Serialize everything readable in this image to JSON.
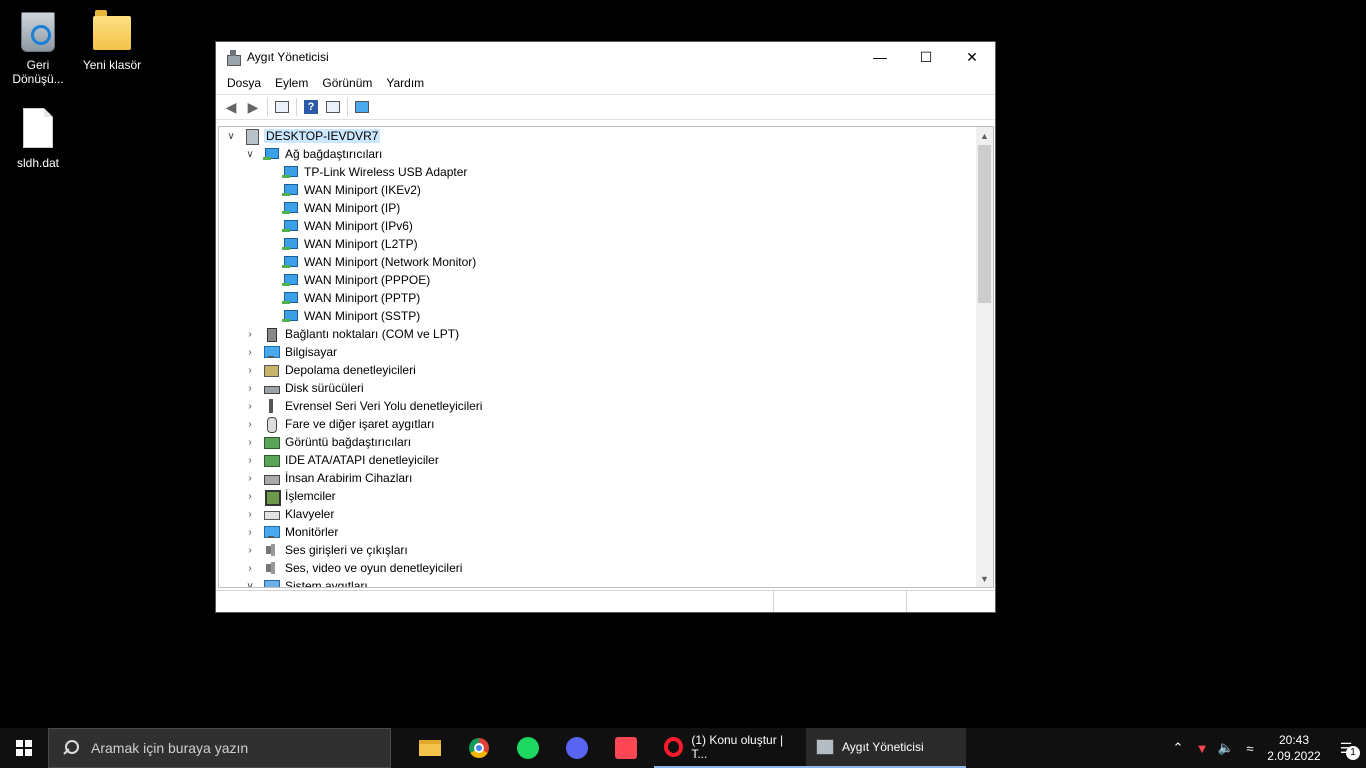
{
  "desktop": {
    "icons": [
      {
        "label": "Geri Dönüşü..."
      },
      {
        "label": "Yeni klasör"
      },
      {
        "label": "sldh.dat"
      }
    ]
  },
  "window": {
    "title": "Aygıt Yöneticisi",
    "controls": {
      "minimize": "—",
      "maximize": "☐",
      "close": "✕"
    },
    "menu": [
      "Dosya",
      "Eylem",
      "Görünüm",
      "Yardım"
    ],
    "tree": {
      "root": "DESKTOP-IEVDVR7",
      "expanded_category": "Ağ bağdaştırıcıları",
      "network_adapters": [
        "TP-Link Wireless USB Adapter",
        "WAN Miniport (IKEv2)",
        "WAN Miniport (IP)",
        "WAN Miniport (IPv6)",
        "WAN Miniport (L2TP)",
        "WAN Miniport (Network Monitor)",
        "WAN Miniport (PPPOE)",
        "WAN Miniport (PPTP)",
        "WAN Miniport (SSTP)"
      ],
      "categories": [
        {
          "label": "Bağlantı noktaları (COM ve LPT)",
          "icon": "port-icon"
        },
        {
          "label": "Bilgisayar",
          "icon": "computer-icon"
        },
        {
          "label": "Depolama denetleyicileri",
          "icon": "storage-controller-icon"
        },
        {
          "label": "Disk sürücüleri",
          "icon": "disk-drive-icon"
        },
        {
          "label": "Evrensel Seri Veri Yolu denetleyicileri",
          "icon": "usb-icon"
        },
        {
          "label": "Fare ve diğer işaret aygıtları",
          "icon": "mouse-icon"
        },
        {
          "label": "Görüntü bağdaştırıcıları",
          "icon": "display-adapter-icon"
        },
        {
          "label": "IDE ATA/ATAPI denetleyiciler",
          "icon": "ide-controller-icon"
        },
        {
          "label": "İnsan Arabirim Cihazları",
          "icon": "hid-icon"
        },
        {
          "label": "İşlemciler",
          "icon": "processor-icon"
        },
        {
          "label": "Klavyeler",
          "icon": "keyboard-icon"
        },
        {
          "label": "Monitörler",
          "icon": "monitor-icon"
        },
        {
          "label": "Ses girişleri ve çıkışları",
          "icon": "audio-io-icon"
        },
        {
          "label": "Ses, video ve oyun denetleyicileri",
          "icon": "sound-controller-icon"
        },
        {
          "label": "Sistem aygıtları",
          "icon": "system-devices-icon"
        }
      ]
    }
  },
  "taskbar": {
    "search_placeholder": "Aramak için buraya yazın",
    "tasks": [
      {
        "label": "(1) Konu oluştur | T..."
      },
      {
        "label": "Aygıt Yöneticisi"
      }
    ],
    "clock": {
      "time": "20:43",
      "date": "2.09.2022"
    },
    "notification_count": "1"
  }
}
